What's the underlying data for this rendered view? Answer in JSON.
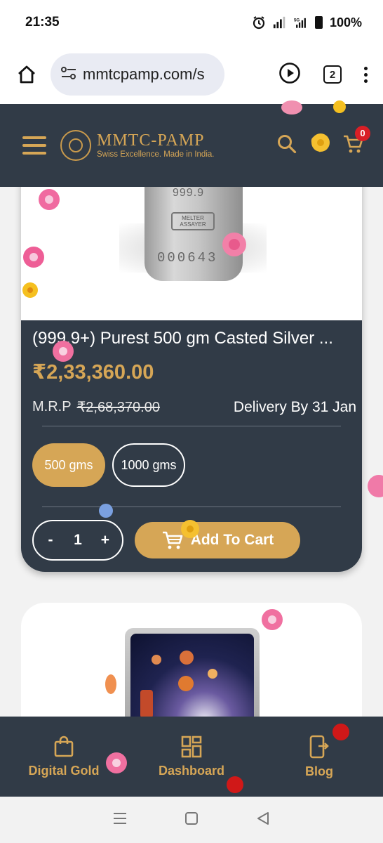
{
  "status_bar": {
    "time": "21:35",
    "battery": "100%",
    "network": "5G"
  },
  "browser": {
    "url": "mmtcpamp.com/s",
    "tab_count": "2"
  },
  "header": {
    "logo_title": "MMTC-PAMP",
    "logo_tagline": "Swiss Excellence. Made in India.",
    "cart_count": "0"
  },
  "product1": {
    "bar_purity": "999.9",
    "bar_stamp": "MELTER ASSAYER",
    "bar_serial": "000643",
    "title": "(999.9+) Purest 500 gm Casted Silver ...",
    "price": "₹2,33,360.00",
    "mrp_label": "M.R.P",
    "mrp_value": "₹2,68,370.00",
    "delivery": "Delivery By 31 Jan",
    "options": [
      "500 gms",
      "1000 gms"
    ],
    "selected_option": "500 gms",
    "qty_minus": "-",
    "quantity": "1",
    "qty_plus": "+",
    "add_to_cart": "Add To Cart"
  },
  "bottom_nav": {
    "items": [
      {
        "label": "Digital Gold",
        "icon": "shopping-bag-icon"
      },
      {
        "label": "Dashboard",
        "icon": "dashboard-grid-icon"
      },
      {
        "label": "Blog",
        "icon": "blog-device-icon"
      }
    ]
  },
  "colors": {
    "brand_dark": "#313b47",
    "brand_gold": "#d6a656",
    "badge_red": "#d91f26"
  }
}
